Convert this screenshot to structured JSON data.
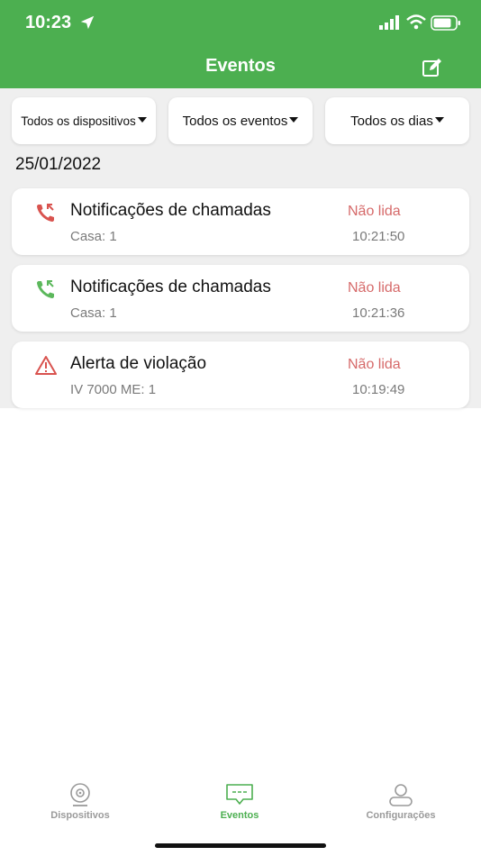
{
  "status_bar": {
    "time": "10:23"
  },
  "header": {
    "title": "Eventos",
    "edit_icon": "edit-icon"
  },
  "filters": [
    {
      "label": "Todos os dispositivos"
    },
    {
      "label": "Todos os eventos"
    },
    {
      "label": "Todos os dias"
    }
  ],
  "date_group": "25/01/2022",
  "events": [
    {
      "icon": "missed-call-icon",
      "icon_color": "#d9534f",
      "title": "Notificações de chamadas",
      "status": "Não lida",
      "subtitle": "Casa: 1",
      "time": "10:21:50"
    },
    {
      "icon": "incoming-call-icon",
      "icon_color": "#5cb85c",
      "title": "Notificações de chamadas",
      "status": "Não lida",
      "subtitle": "Casa: 1",
      "time": "10:21:36"
    },
    {
      "icon": "warning-icon",
      "icon_color": "#d9534f",
      "title": "Alerta de violação",
      "status": "Não lida",
      "subtitle": "IV 7000 ME: 1",
      "time": "10:19:49"
    }
  ],
  "tabs": [
    {
      "label": "Dispositivos",
      "icon": "camera-icon",
      "active": false
    },
    {
      "label": "Eventos",
      "icon": "chat-icon",
      "active": true
    },
    {
      "label": "Configurações",
      "icon": "user-icon",
      "active": false
    }
  ],
  "colors": {
    "brand": "#4caf50",
    "unread": "#d66a6a"
  }
}
